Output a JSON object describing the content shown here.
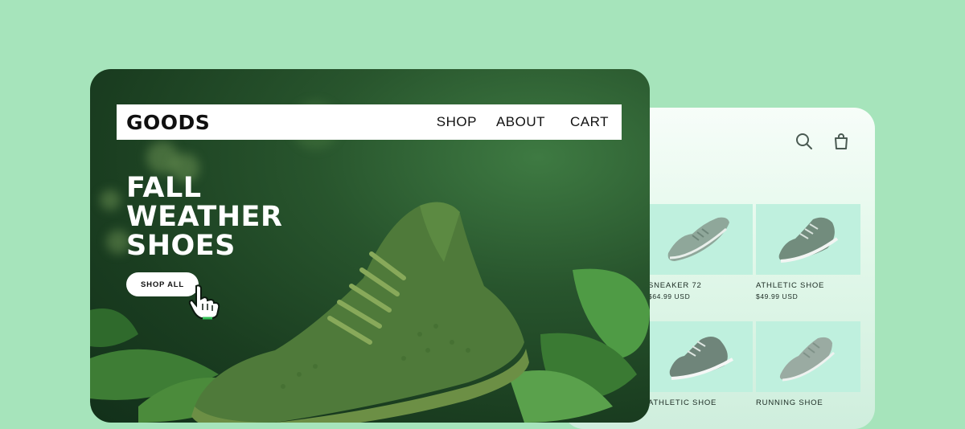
{
  "brand": {
    "logo": "GOODS"
  },
  "nav": {
    "shop": "SHOP",
    "about": "ABOUT",
    "cart": "CART"
  },
  "hero": {
    "headline": [
      "FALL",
      "WEATHER",
      "SHOES"
    ],
    "cta": "SHOP ALL"
  },
  "header_icons": [
    "search-icon",
    "shopping-bag-icon"
  ],
  "products": [
    {
      "name": "SNEAKER 72",
      "price": "$64.99 USD"
    },
    {
      "name": "ATHLETIC SHOE",
      "price": "$49.99 USD"
    },
    {
      "name": "ATHLETIC SHOE",
      "price": ""
    },
    {
      "name": "RUNNING SHOE",
      "price": ""
    }
  ],
  "colors": {
    "background": "#a6e4bb",
    "hero_dark": "#1a3d20",
    "product_tile": "#bff0de",
    "shoe": "#4f7a3a"
  }
}
